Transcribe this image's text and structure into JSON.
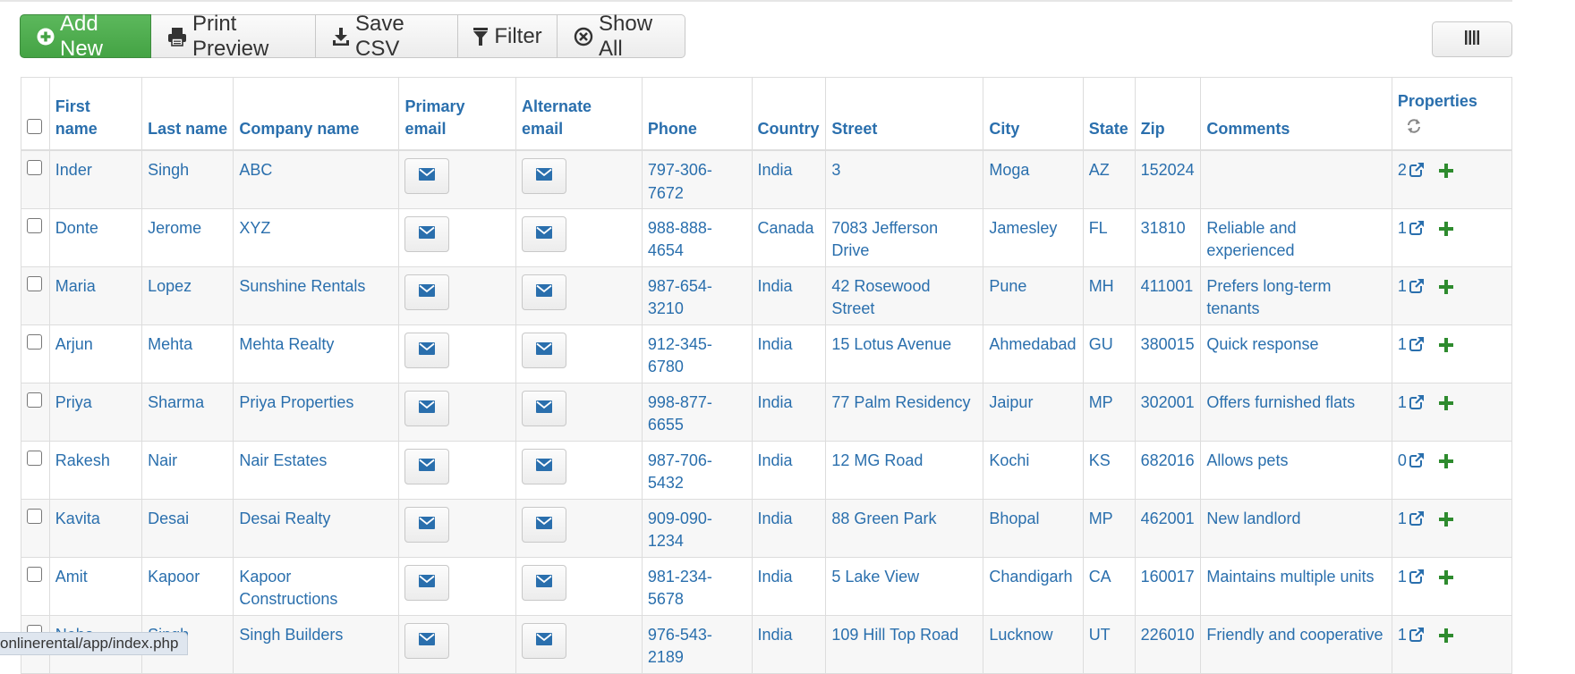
{
  "toolbar": {
    "add_new": "Add New",
    "print_preview": "Print Preview",
    "save_csv": "Save CSV",
    "filter": "Filter",
    "show_all": "Show All"
  },
  "colors": {
    "accent": "#2a6fad",
    "success": "#44a344"
  },
  "columns": {
    "first_name": "First name",
    "last_name": "Last name",
    "company_name": "Company name",
    "primary_email": "Primary email",
    "alternate_email": "Alternate email",
    "phone": "Phone",
    "country": "Country",
    "street": "Street",
    "city": "City",
    "state": "State",
    "zip": "Zip",
    "comments": "Comments",
    "properties": "Properties"
  },
  "rows": [
    {
      "first": "Inder",
      "last": "Singh",
      "company": "ABC",
      "phone": "797-306-7672",
      "country": "India",
      "street": "3",
      "city": "Moga",
      "state": "AZ",
      "zip": "152024",
      "comments": "",
      "props": "2"
    },
    {
      "first": "Donte",
      "last": "Jerome",
      "company": "XYZ",
      "phone": "988-888-4654",
      "country": "Canada",
      "street": "7083 Jefferson Drive",
      "city": "Jamesley",
      "state": "FL",
      "zip": "31810",
      "comments": "Reliable and experienced",
      "props": "1"
    },
    {
      "first": "Maria",
      "last": "Lopez",
      "company": "Sunshine Rentals",
      "phone": "987-654-3210",
      "country": "India",
      "street": "42 Rosewood Street",
      "city": "Pune",
      "state": "MH",
      "zip": "411001",
      "comments": "Prefers long-term tenants",
      "props": "1"
    },
    {
      "first": "Arjun",
      "last": "Mehta",
      "company": "Mehta Realty",
      "phone": "912-345-6780",
      "country": "India",
      "street": "15 Lotus Avenue",
      "city": "Ahmedabad",
      "state": "GU",
      "zip": "380015",
      "comments": "Quick response",
      "props": "1"
    },
    {
      "first": "Priya",
      "last": "Sharma",
      "company": "Priya Properties",
      "phone": "998-877-6655",
      "country": "India",
      "street": "77 Palm Residency",
      "city": "Jaipur",
      "state": "MP",
      "zip": "302001",
      "comments": "Offers furnished flats",
      "props": "1"
    },
    {
      "first": "Rakesh",
      "last": "Nair",
      "company": "Nair Estates",
      "phone": "987-706-5432",
      "country": "India",
      "street": "12 MG Road",
      "city": "Kochi",
      "state": "KS",
      "zip": "682016",
      "comments": "Allows pets",
      "props": "0"
    },
    {
      "first": "Kavita",
      "last": "Desai",
      "company": "Desai Realty",
      "phone": "909-090-1234",
      "country": "India",
      "street": "88 Green Park",
      "city": "Bhopal",
      "state": "MP",
      "zip": "462001",
      "comments": "New landlord",
      "props": "1"
    },
    {
      "first": "Amit",
      "last": "Kapoor",
      "company": "Kapoor Constructions",
      "phone": "981-234-5678",
      "country": "India",
      "street": "5 Lake View",
      "city": "Chandigarh",
      "state": "CA",
      "zip": "160017",
      "comments": "Maintains multiple units",
      "props": "1"
    },
    {
      "first": "Neha",
      "last": "Singh",
      "company": "Singh Builders",
      "phone": "976-543-2189",
      "country": "India",
      "street": "109 Hill Top Road",
      "city": "Lucknow",
      "state": "UT",
      "zip": "226010",
      "comments": "Friendly and cooperative",
      "props": "1"
    }
  ],
  "status_url": "onlinerental/app/index.php"
}
